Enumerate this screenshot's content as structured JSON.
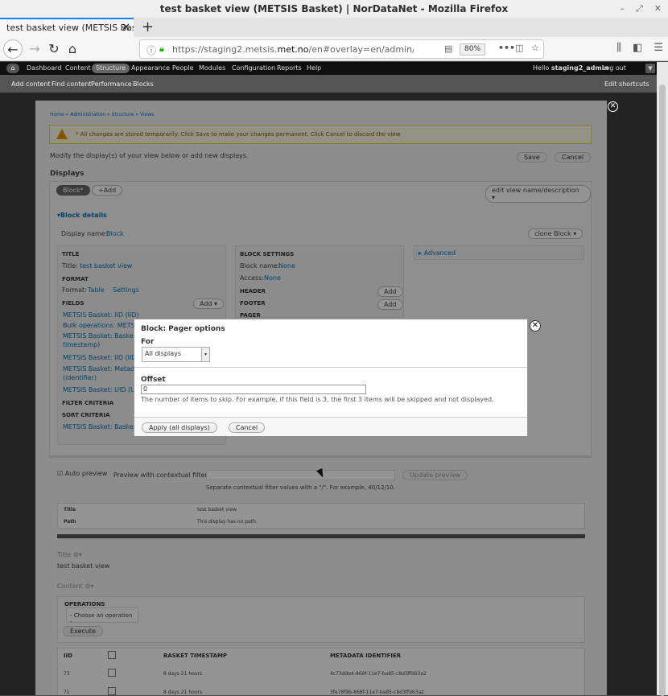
{
  "window": {
    "title": "test basket view (METSIS Basket) | NorDataNet - Mozilla Firefox"
  },
  "tab": {
    "label": "test basket view (METSIS Basket)"
  },
  "urlbar": {
    "url_prefix": "https://staging2.metsis.",
    "url_domain": "met.no",
    "url_suffix": "/en#overlay=en/admin/structure/views/view",
    "zoom": "80%"
  },
  "toolbar": {
    "items": [
      "Dashboard",
      "Content",
      "Structure",
      "Appearance",
      "People",
      "Modules",
      "Configuration",
      "Reports",
      "Help"
    ],
    "hello_prefix": "Hello ",
    "user": "staging2_admin",
    "logout": "Log out"
  },
  "shortcuts": {
    "items": [
      "Add content",
      "Find content",
      "Performance",
      "Blocks"
    ],
    "edit": "Edit shortcuts"
  },
  "page": {
    "breadcrumb": "Home » Administration » Structure » Views",
    "warning": "* All changes are stored temporarily. Click Save to make your changes permanent. Click Cancel to discard the view",
    "intro": "Modify the display(s) of your view below or add new displays.",
    "save": "Save",
    "cancel": "Cancel",
    "displays_title": "Displays",
    "display_tab": "Block*",
    "add": "+Add",
    "edit_name": "edit view name/description",
    "block_details": "Block details",
    "display_name_label": "Display name:",
    "display_name_value": "Block",
    "clone": "clone Block",
    "title_hdr": "TITLE",
    "title_label": "Title:",
    "title_value": "test basket view",
    "format_hdr": "FORMAT",
    "format_label": "Format:",
    "format_value": "Table",
    "format_settings": "Settings",
    "fields_hdr": "FIELDS",
    "fields_add": "Add",
    "fields": [
      "METSIS Basket: IID (IID)",
      "Bulk operations: METSIS",
      "METSIS Basket: Basket t",
      "timestamp)",
      "METSIS Basket: IID (IID)",
      "METSIS Basket: Metadat",
      "(identifier)",
      "METSIS Basket: UID (UID"
    ],
    "filter_hdr": "FILTER CRITERIA",
    "sort_hdr": "SORT CRITERIA",
    "sort_item": "METSIS Basket: Basket",
    "block_settings_hdr": "BLOCK SETTINGS",
    "block_name_label": "Block name:",
    "block_name_value": "None",
    "access_label": "Access:",
    "access_value": "None",
    "header_hdr": "HEADER",
    "footer_hdr": "FOOTER",
    "pager_hdr": "PAGER",
    "advanced": "Advanced",
    "auto_preview": "Auto preview",
    "preview_label": "Preview with contextual filters:",
    "update_preview": "Update preview",
    "preview_hint": "Separate contextual filter values with a \"/\". For example, 40/12/10.",
    "info_rows": [
      [
        "Title",
        "test basket view"
      ],
      [
        "Path",
        "This display has no path."
      ]
    ],
    "title_section": "Title",
    "title_preview": "test basket view",
    "content_section": "Content",
    "operations_hdr": "OPERATIONS",
    "choose_op": "- Choose an operation -",
    "execute": "Execute",
    "columns": [
      "IID",
      "",
      "BASKET TIMESTAMP",
      "METADATA IDENTIFIER"
    ],
    "rows": [
      [
        "73",
        "",
        "8 days 21 hours",
        "4c73dde4-868f-11e7-ba85-c8d3ffd63a2"
      ],
      [
        "71",
        "",
        "8 days 21 hours",
        "3fe78f9b-868f-11e7-ba85-c8d3ffd63a2"
      ]
    ]
  },
  "dialog": {
    "title": "Block: Pager options",
    "for_label": "For",
    "for_value": "All displays",
    "offset_label": "Offset",
    "offset_value": "0",
    "description": "The number of items to skip. For example, if this field is 3, the first 3 items will be skipped and not displayed.",
    "apply": "Apply (all displays)",
    "cancel": "Cancel"
  }
}
